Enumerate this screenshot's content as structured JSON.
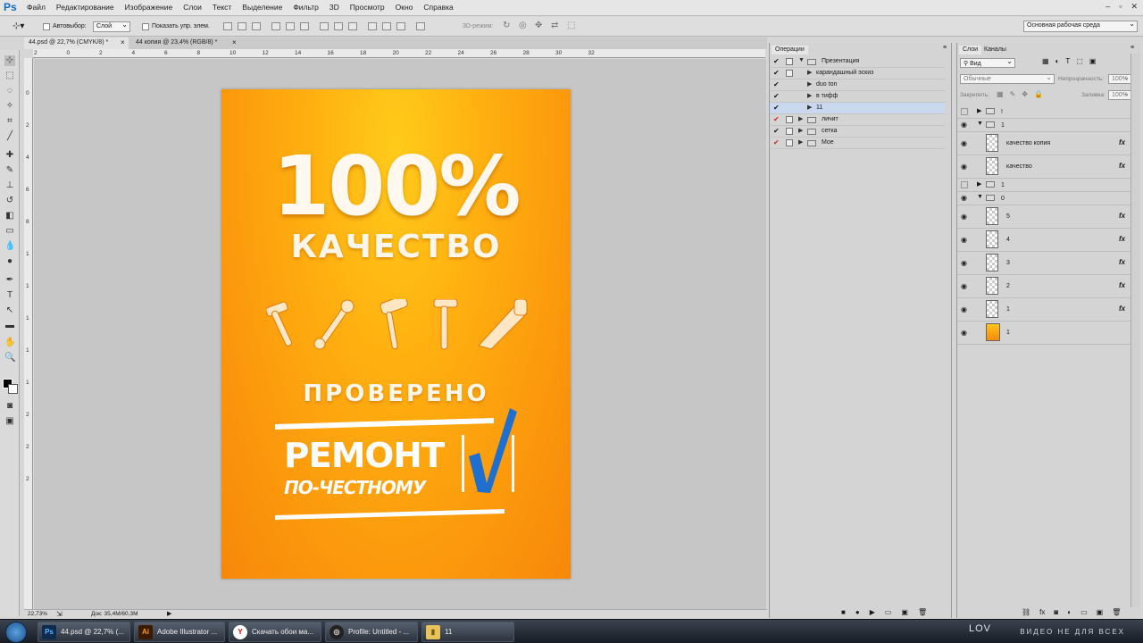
{
  "app": {
    "logo": "Ps"
  },
  "menu": [
    "Файл",
    "Редактирование",
    "Изображение",
    "Слои",
    "Текст",
    "Выделение",
    "Фильтр",
    "3D",
    "Просмотр",
    "Окно",
    "Справка"
  ],
  "options": {
    "auto_select_label": "Автовыбор:",
    "auto_select_value": "Слой",
    "show_transform_label": "Показать упр. элем.",
    "mode_3d": "3D-режим:",
    "workspace": "Основная рабочая среда"
  },
  "doc_tabs": [
    "44.psd @ 22,7% (CMYK/8) *",
    "44 копия @ 23,4% (RGB/8) *"
  ],
  "ruler_h": [
    "2",
    "0",
    "2",
    "4",
    "6",
    "8",
    "10",
    "12",
    "14",
    "16",
    "18",
    "20",
    "22",
    "24",
    "26",
    "28",
    "30",
    "32"
  ],
  "ruler_v": [
    "0",
    "2",
    "4",
    "6",
    "8",
    "1",
    "1",
    "1",
    "1",
    "1",
    "2",
    "2",
    "2"
  ],
  "poster": {
    "big": "100%",
    "quality": "КАЧЕСТВО",
    "checked": "ПРОВЕРЕНО",
    "repair1": "РЕМОНТ",
    "repair2": "ПО-ЧЕСТНОМУ"
  },
  "status": {
    "zoom": "22,73%",
    "doc": "Док: 35,4М/60,3М"
  },
  "ops_panel": {
    "tab": "Операции",
    "rows": [
      "Презентация",
      "карандашный эскиз",
      "duo ton",
      "в тифф",
      "11",
      "личит",
      "сетка",
      "Мое"
    ]
  },
  "layers_panel": {
    "tabs": [
      "Слои",
      "Каналы"
    ],
    "filter": "Вид",
    "blend": "Обычные",
    "opacity_label": "Непрозрачность:",
    "opacity": "100%",
    "lock_label": "Закрепить:",
    "fill_label": "Заливка:",
    "fill": "100%",
    "layers": [
      "!",
      "1",
      "качество копия",
      "качество",
      "1",
      "0",
      "5",
      "4",
      "3",
      "2",
      "1",
      "1"
    ]
  },
  "taskbar": {
    "items": [
      "44.psd @ 22,7% (...",
      "Adobe Illustrator ...",
      "Скачать обои ма...",
      "Profile: Untitled - ...",
      "11"
    ],
    "watermark": "ВИДЕО НЕ ДЛЯ ВСЕХ",
    "wm_logo": "LOV"
  },
  "colors": {
    "poster_orange": "#fb960c",
    "accent_blue": "#1f6fd0",
    "ps_blue": "#0e6dc4"
  }
}
